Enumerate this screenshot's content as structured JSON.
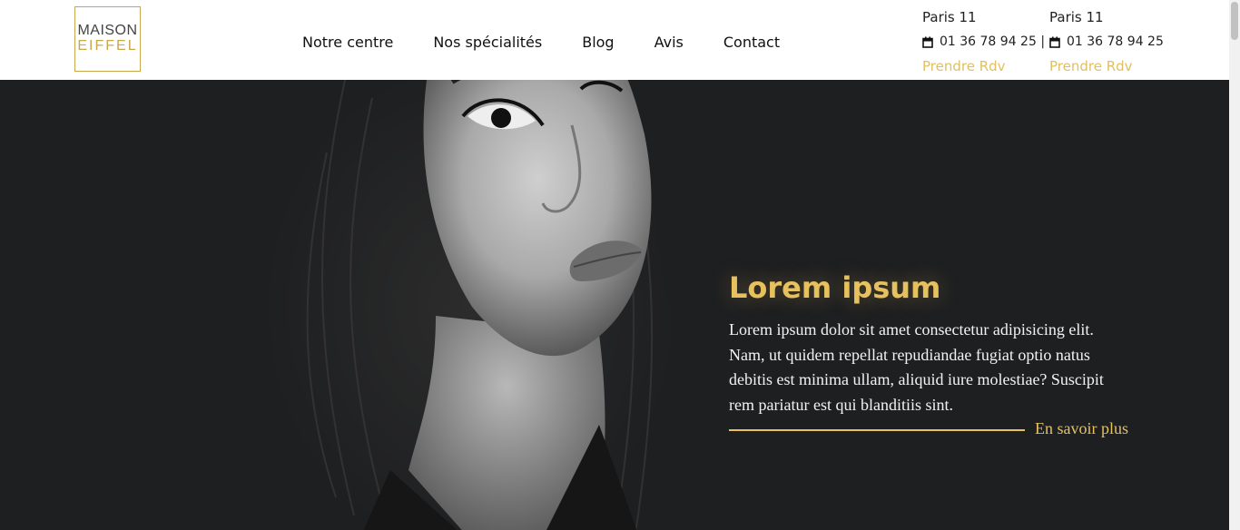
{
  "brand": {
    "line1": "MAISON",
    "line2": "EIFFEL"
  },
  "nav": {
    "items": [
      {
        "label": "Notre centre"
      },
      {
        "label": "Nos spécialités"
      },
      {
        "label": "Blog"
      },
      {
        "label": "Avis"
      },
      {
        "label": "Contact"
      }
    ]
  },
  "contacts": [
    {
      "city": "Paris 11",
      "phone": "01 36 78 94 25 |",
      "cta": "Prendre Rdv"
    },
    {
      "city": "Paris 11",
      "phone": "01 36 78 94 25",
      "cta": "Prendre Rdv"
    }
  ],
  "hero": {
    "title": "Lorem ipsum",
    "description": "Lorem ipsum dolor sit amet consectetur adipisicing elit. Nam, ut quidem repellat repudiandae fugiat optio natus debitis est minima ullam, aliquid iure molestiae? Suscipit rem pariatur est qui blanditiis sint.",
    "cta_label": "En savoir plus"
  },
  "colors": {
    "accent": "#e7c15e",
    "hero_background": "#1e1f21",
    "logo_gold": "#c9a84c"
  },
  "icons": {
    "phone": "calendar-icon"
  }
}
